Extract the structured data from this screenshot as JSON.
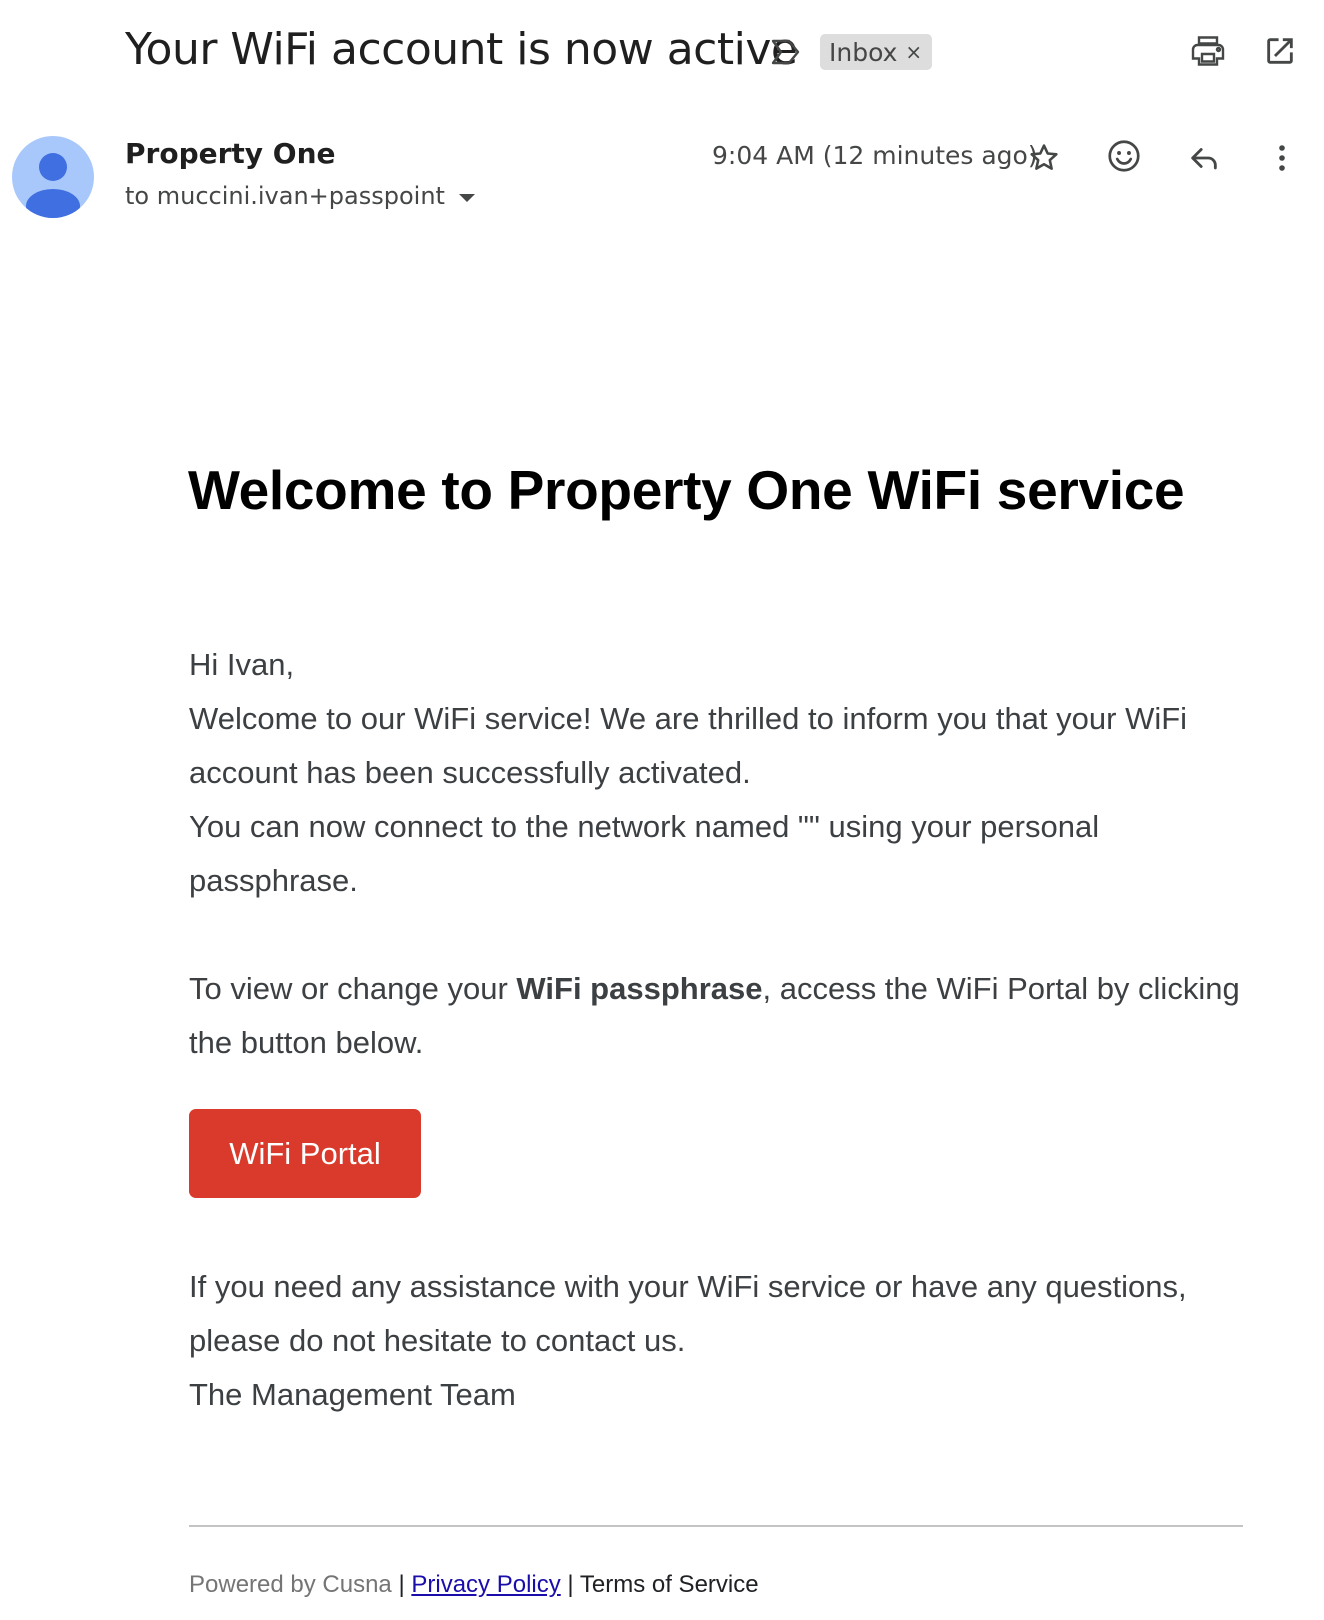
{
  "email": {
    "subject": "Your WiFi account is now active",
    "label": "Inbox",
    "label_remove": "×",
    "sender": "Property One",
    "recipient": "to muccini.ivan+passpoint",
    "timestamp": "9:04 AM (12 minutes ago)"
  },
  "icons": {
    "importance": "label-important-icon",
    "print": "print-icon",
    "open_new_window": "open-in-new-icon",
    "star": "star-icon",
    "emoji": "emoji-react-icon",
    "reply": "reply-icon",
    "more": "more-vert-icon"
  },
  "body": {
    "heading": "Welcome to Property One WiFi service",
    "greeting": "Hi Ivan,",
    "p1": "Welcome to our WiFi service! We are thrilled to inform you that your WiFi account has been successfully activated.",
    "p2": "You can now connect to the network named \"\" using your personal passphrase.",
    "p3_before": "To view or change your ",
    "p3_bold": "WiFi passphrase",
    "p3_after": ", access the WiFi Portal by clicking the button below.",
    "button": "WiFi Portal",
    "p4": "If you need any assistance with your WiFi service or have any questions, please do not hesitate to contact us.",
    "signoff": "The Management Team"
  },
  "footer": {
    "powered": "Powered by Cusna",
    "sep1": " | ",
    "privacy": "Privacy Policy",
    "sep2": " | ",
    "terms": "Terms of Service"
  },
  "colors": {
    "button_bg": "#d93a2b",
    "avatar_bg": "#a8c7fa",
    "avatar_fg": "#3f6fe0",
    "link": "#1a0dab"
  }
}
